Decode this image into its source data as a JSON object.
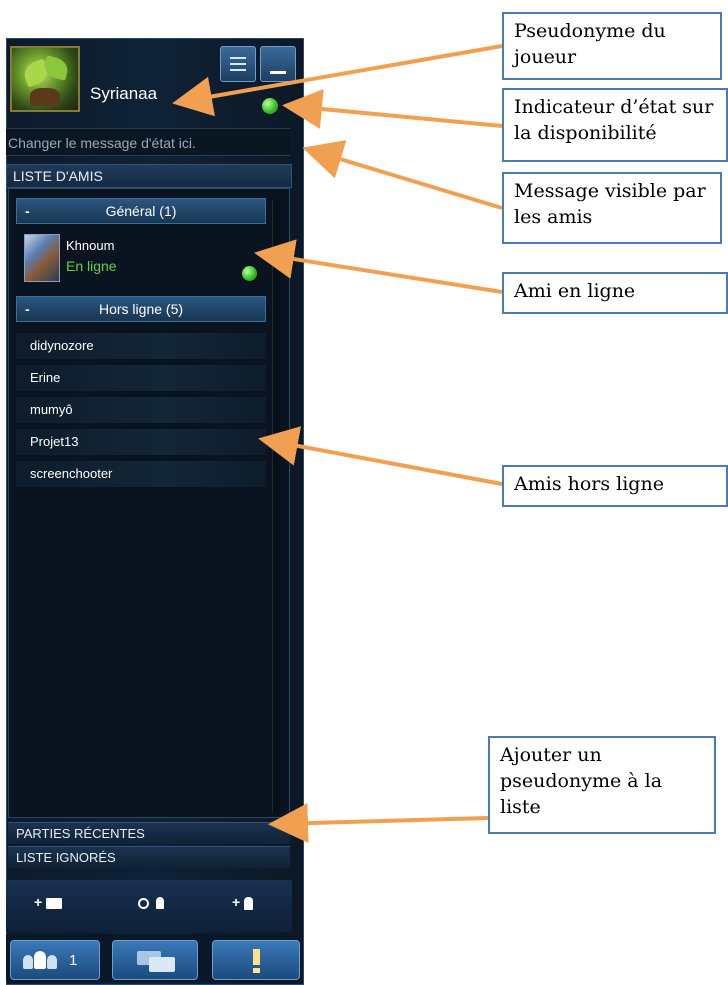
{
  "player": {
    "username": "Syrianaa",
    "status_message_placeholder": "Changer le message d'état ici."
  },
  "friends_list": {
    "header": "LISTE D'AMIS",
    "groups": [
      {
        "title": "Général (1)",
        "collapse_symbol": "-",
        "members": [
          {
            "name": "Khnoum",
            "state": "En ligne"
          }
        ]
      },
      {
        "title": "Hors ligne (5)",
        "collapse_symbol": "-",
        "members": [
          {
            "name": "didynozore"
          },
          {
            "name": "Erine"
          },
          {
            "name": "mumyô"
          },
          {
            "name": "Projet13"
          },
          {
            "name": "screenchooter"
          }
        ]
      }
    ]
  },
  "sections": {
    "recent_games": "PARTIES RÉCENTES",
    "ignored_list": "LISTE IGNORÉS"
  },
  "action_bar": {
    "add_group": "+",
    "search": "",
    "add_friend": "+"
  },
  "tabs": {
    "friends_count": "1"
  },
  "annotations": [
    {
      "text": "Pseudonyme du joueur"
    },
    {
      "text": "Indicateur d’état sur la disponibilité"
    },
    {
      "text": "Message visible par les amis"
    },
    {
      "text": "Ami en ligne"
    },
    {
      "text": "Amis hors ligne"
    },
    {
      "text": "Ajouter un pseudonyme à la liste"
    }
  ],
  "colors": {
    "panel_bg": "#0f2236",
    "online_green": "#5fd24a",
    "callout_border": "#4a7bb7",
    "arrow": "#f0a050"
  }
}
